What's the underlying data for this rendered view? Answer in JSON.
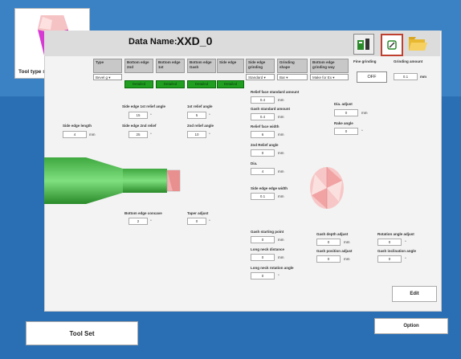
{
  "header": {
    "data_name_label": "Data Name:",
    "data_name_value": "XXD_0"
  },
  "tool_type": {
    "label": "Tool type setting"
  },
  "columns": [
    {
      "label": "Type",
      "value": "Bevel g"
    },
    {
      "label": "Bottom edge 2nd",
      "value": ""
    },
    {
      "label": "Bottom edge 1st",
      "value": ""
    },
    {
      "label": "Bottom edge Gash",
      "value": ""
    },
    {
      "label": "Side edge",
      "value": ""
    },
    {
      "label": "Side edge grinding",
      "value": "Standard"
    },
    {
      "label": "Grinding shape",
      "value": "Bar"
    },
    {
      "label": "Bottom edge grinding way",
      "value": "Make for Ex"
    }
  ],
  "fine_grinding": {
    "label": "Fine grinding",
    "value": "OFF"
  },
  "grinding_amount": {
    "label": "Grinding amount",
    "value": "0.1",
    "unit": "mm"
  },
  "green_tabs": [
    "Detailed",
    "Detailed",
    "Detailed",
    "Detailed"
  ],
  "fields": {
    "side_edge_length": {
      "label": "Side edge length",
      "value": "4",
      "unit": "mm"
    },
    "side_edge_1st_relief": {
      "label": "Side edge 1st relief angle",
      "value": "15",
      "unit": "°"
    },
    "side_edge_2nd_relief": {
      "label": "Side edge 2nd relief",
      "value": "25",
      "unit": "°"
    },
    "first_relief_angle": {
      "label": "1st relief angle",
      "value": "5",
      "unit": "°"
    },
    "second_relief_angle": {
      "label": "2nd relief angle",
      "value": "10",
      "unit": "°"
    },
    "relief_face_std": {
      "label": "Relief face standard amount",
      "value": "0.4",
      "unit": "mm"
    },
    "gash_std": {
      "label": "Gash standard amount",
      "value": "0.4",
      "unit": "mm"
    },
    "relief_face_width": {
      "label": "Relief face width",
      "value": "6",
      "unit": "mm"
    },
    "second_relief_angle_b": {
      "label": "2nd Relief angle",
      "value": "0",
      "unit": "mm"
    },
    "dia": {
      "label": "Dia.",
      "value": "4",
      "unit": "mm"
    },
    "side_edge_width": {
      "label": "Side edge edge width",
      "value": "0.1",
      "unit": "mm"
    },
    "dia_adjust": {
      "label": "Dia. adjust",
      "value": "0",
      "unit": "mm"
    },
    "rake_angle": {
      "label": "Rake angle",
      "value": "0",
      "unit": "°"
    },
    "bottom_edge_concave": {
      "label": "Bottom edge concave",
      "value": "2",
      "unit": "°"
    },
    "taper_adjust": {
      "label": "Taper adjust",
      "value": "0",
      "unit": "°"
    },
    "gash_starting_point": {
      "label": "Gash starting point",
      "value": "0",
      "unit": "mm"
    },
    "long_neck_distance": {
      "label": "Long neck distance",
      "value": "0",
      "unit": "mm"
    },
    "long_neck_rotation": {
      "label": "Long neck rotation angle",
      "value": "0",
      "unit": "°"
    },
    "gash_depth_adjust": {
      "label": "Gash depth adjust",
      "value": "0",
      "unit": "mm"
    },
    "gash_position_adjust": {
      "label": "Gash position adjust",
      "value": "0",
      "unit": "mm"
    },
    "rotation_angle_adjust": {
      "label": "Rotation angle adjust",
      "value": "0",
      "unit": "°"
    },
    "gash_inclination_angle": {
      "label": "Gash inclination angle",
      "value": "0",
      "unit": "°"
    }
  },
  "buttons": {
    "edit": "Edit",
    "tool_set": "Tool Set",
    "option": "Option"
  },
  "colors": {
    "background": "#2a6fb3",
    "green": "#1f9e1f",
    "tool_green": "#4cc84c",
    "tool_pink": "#f4b0b0"
  }
}
